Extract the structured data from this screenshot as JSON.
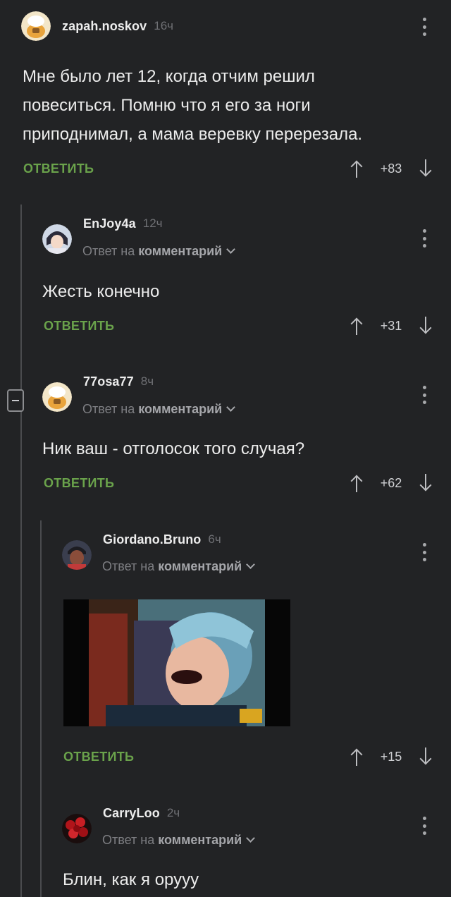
{
  "comments": [
    {
      "username": "zapah.noskov",
      "time": "16ч",
      "text_lines": [
        "Мне было лет 12, когда отчим решил",
        "повеситься. Помню что я его за ноги",
        "приподнимал, а мама веревку перерезала."
      ],
      "reply_label": "ОТВЕТИТЬ",
      "score": "+83",
      "avatar": "cartoon-face-avatar"
    },
    {
      "username": "EnJoy4a",
      "time": "12ч",
      "reply_prefix": "Ответ на",
      "reply_target": "комментарий",
      "text": "Жесть конечно",
      "reply_label": "ОТВЕТИТЬ",
      "score": "+31",
      "avatar": "anime-girl-avatar"
    },
    {
      "username": "77osa77",
      "time": "8ч",
      "reply_prefix": "Ответ на",
      "reply_target": "комментарий",
      "text": "Ник ваш - отголосок того случая?",
      "reply_label": "ОТВЕТИТЬ",
      "score": "+62",
      "avatar": "cartoon-face-avatar"
    },
    {
      "username": "Giordano.Bruno",
      "time": "6ч",
      "reply_prefix": "Ответ на",
      "reply_target": "комментарий",
      "media": "laughing-man-gif",
      "reply_label": "ОТВЕТИТЬ",
      "score": "+15",
      "avatar": "cartoon-man-avatar"
    },
    {
      "username": "CarryLoo",
      "time": "2ч",
      "reply_prefix": "Ответ на",
      "reply_target": "комментарий",
      "text": "Блин, как я орууу",
      "avatar": "red-roses-avatar"
    }
  ],
  "colors": {
    "background": "#222325",
    "reply_accent": "#6aa24b",
    "thread_line": "#4a4b4e"
  }
}
